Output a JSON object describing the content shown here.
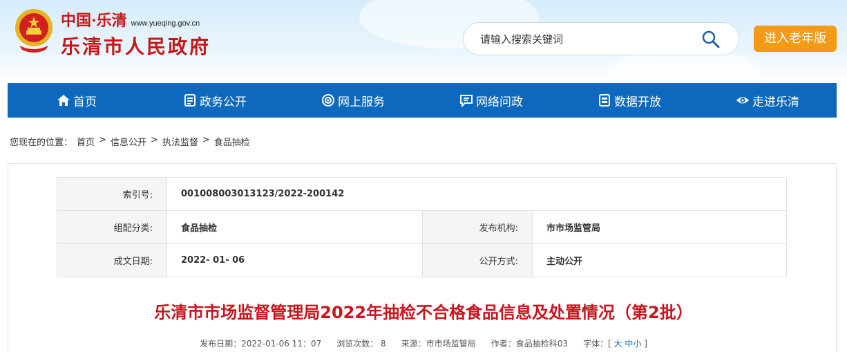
{
  "header": {
    "brand_cn": "中国·乐清",
    "brand_url": "www.yueqing.gov.cn",
    "brand_main": "乐清市人民政府",
    "search_placeholder": "请输入搜索关键词",
    "elder_button": "进入老年版"
  },
  "nav": [
    {
      "label": "首页",
      "icon": "home-icon"
    },
    {
      "label": "政务公开",
      "icon": "document-icon"
    },
    {
      "label": "网上服务",
      "icon": "service-icon"
    },
    {
      "label": "网络问政",
      "icon": "chat-icon"
    },
    {
      "label": "数据开放",
      "icon": "data-icon"
    },
    {
      "label": "走进乐清",
      "icon": "eye-icon"
    }
  ],
  "breadcrumb": {
    "prefix": "您现在的位置：",
    "items": [
      "首页",
      "信息公开",
      "执法监督",
      "食品抽检"
    ]
  },
  "meta": {
    "index_label": "索引号:",
    "index_value": "001008003013123/2022-200142",
    "category_label": "组配分类:",
    "category_value": "食品抽检",
    "publisher_label": "发布机构:",
    "publisher_value": "市市场监管局",
    "date_label": "成文日期:",
    "date_value": "2022- 01- 06",
    "mode_label": "公开方式:",
    "mode_value": "主动公开"
  },
  "article": {
    "title": "乐清市市场监督管理局2022年抽检不合格食品信息及处置情况（第2批）",
    "publish_date": "发布日期：2022-01-06 11：07",
    "views": "浏览次数：  8",
    "source": "来源：市市场监管局",
    "author": "作者：食品抽检科03",
    "font_label": "字体：[",
    "font_large": "大",
    "font_medium": "中",
    "font_small": "小",
    "font_close": "]"
  },
  "colors": {
    "nav_bg": "#0c69bd",
    "brand_red": "#c41818",
    "title_red": "#c9151e",
    "elder_orange": "#f39a17"
  }
}
